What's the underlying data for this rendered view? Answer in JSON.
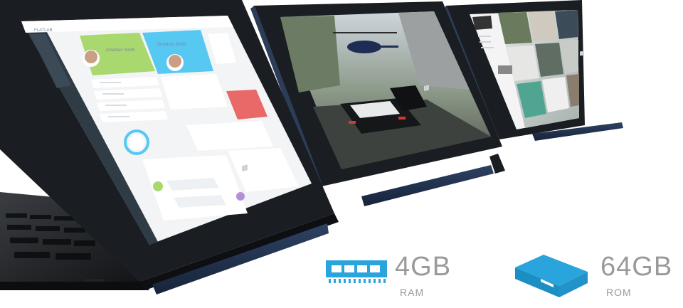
{
  "specs": {
    "ram": {
      "value": "4GB",
      "label": "RAM",
      "icon": "memory-module-icon"
    },
    "rom": {
      "value": "64GB",
      "label": "ROM",
      "icon": "storage-drive-icon"
    }
  },
  "left_tablet_screen": {
    "app_title": "FLATLAB",
    "profile_names": [
      "Jonathan Smith",
      "Jonathan Smith"
    ],
    "icons": [
      "menu-icon",
      "avatar-icon"
    ]
  },
  "colors": {
    "accent_blue": "#1a9bd7",
    "profile_green": "#a9d86e",
    "profile_blue": "#57c8f2",
    "tile_red": "#e96868",
    "bezel": "#1a1d21",
    "hinge_navy": "#24354e",
    "spec_grey": "#9a9a9a"
  }
}
